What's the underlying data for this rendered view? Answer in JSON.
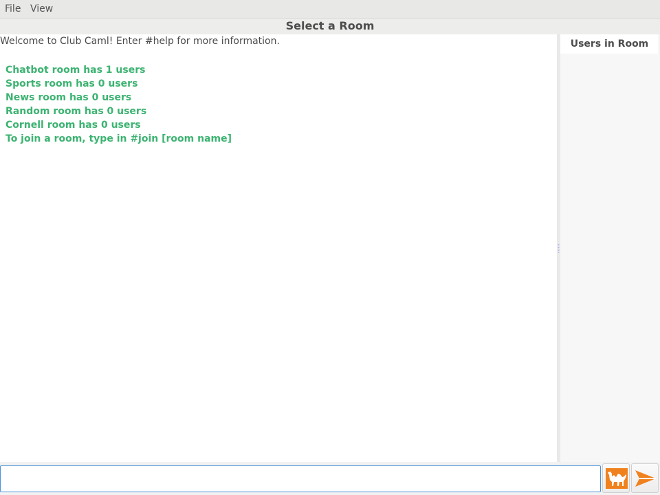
{
  "menubar": {
    "items": [
      {
        "label": "File"
      },
      {
        "label": "View"
      }
    ]
  },
  "header": {
    "title": "Select a Room"
  },
  "chat": {
    "welcome": "Welcome to Club Caml! Enter #help for more information.",
    "lines": [
      "Chatbot room has 1 users",
      "Sports room has 0 users",
      "News room has 0 users",
      "Random room has 0 users",
      "Cornell room has 0 users",
      "To join a room, type in #join [room name]"
    ],
    "line_color": "#3cb371"
  },
  "users_panel": {
    "title": "Users in Room"
  },
  "input": {
    "value": "",
    "placeholder": ""
  },
  "buttons": {
    "camel_icon": "camel-icon",
    "send_icon": "send-arrow-icon",
    "accent_color": "#f0821e"
  }
}
